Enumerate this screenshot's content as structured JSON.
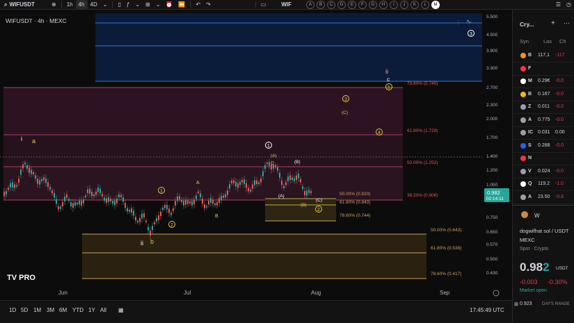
{
  "topbar": {
    "symbol": "WIFUSDT",
    "intervals": [
      "1h",
      "4h",
      "4D"
    ],
    "watch_symbol": "WIF",
    "letters": [
      "A",
      "B",
      "C",
      "D",
      "E",
      "F",
      "G",
      "H",
      "I",
      "J",
      "K",
      "L",
      "M"
    ],
    "selected_letter": "M"
  },
  "chart": {
    "legend": "WIFUSDT · 4h · MEXC",
    "price_axis": [
      "5.500",
      "4.500",
      "3.900",
      "3.300",
      "2.700",
      "2.300",
      "2.000",
      "1.700",
      "1.400",
      "1.200",
      "1.050",
      "0.900",
      "0.750",
      "0.650",
      "0.570",
      "0.500",
      "0.430"
    ],
    "current_price": "0.982",
    "countdown": "02:14:11",
    "time_axis": [
      "Jun",
      "Jul",
      "Aug",
      "Sep"
    ],
    "fib_labels": {
      "f7860_top": "78.60% (2.740)",
      "f6180_top": "61.80% (1.729)",
      "f5000_top": "50.00% (1.252)",
      "f3820": "38.20% (0.906)",
      "f5000_mid": "50.00% (0.920)",
      "f6180_mid": "61.80% (0.843)",
      "f7860_mid": "78.60% (0.744)",
      "f5000_low": "50.00% (0.643)",
      "f6180_low": "61.80% (0.538)",
      "f7860_low": "78.60% (0.417)"
    },
    "wave_labels": {
      "i": "i",
      "a": "a",
      "ii": "ii",
      "b": "b",
      "w1": "1",
      "w2": "2",
      "A": "A",
      "B": "B",
      "c1": "1",
      "paren_A": "(A)",
      "c_small": "C",
      "paren_B": "(B)",
      "paren_A2": "(A)",
      "paren_B2": "(B)",
      "paren_C": "(C)",
      "c2": "2",
      "top_ii": "ii",
      "top_c": "c",
      "top_5": "5",
      "top_3": "3",
      "paren_C_top": "(C)",
      "top_4": "4",
      "corner_3": "3"
    },
    "logo": "TV PRO"
  },
  "bottombar": {
    "ranges": [
      "1D",
      "5D",
      "1M",
      "3M",
      "6M",
      "YTD",
      "1Y",
      "All"
    ],
    "time": "17:45:49 UTC"
  },
  "watchlist": {
    "title": "Cry...",
    "columns": [
      "Syn",
      "Las",
      "Ch"
    ],
    "rows": [
      {
        "name": "B",
        "last": "117,1",
        "chg": "-117",
        "icon": "#f7931a",
        "chg_color": "#f23645"
      },
      {
        "name": "F",
        "last": "",
        "chg": "",
        "icon": "#f23645",
        "chg_color": "#f23645"
      },
      {
        "name": "M",
        "last": "0.29€",
        "chg": "-0.0",
        "icon": "#ffffff",
        "chg_color": "#f23645"
      },
      {
        "name": "B",
        "last": "0.167",
        "chg": "-0.0",
        "icon": "#f0b90b",
        "chg_color": "#f23645"
      },
      {
        "name": "Z",
        "last": "0.011",
        "chg": "-0.0",
        "icon": "#9aa0a6",
        "chg_color": "#f23645"
      },
      {
        "name": "A",
        "last": "0.775",
        "chg": "-0.0",
        "icon": "#9aa0a6",
        "chg_color": "#f23645"
      },
      {
        "name": "IC",
        "last": "0.031",
        "chg": "0.00",
        "icon": "#9aa0a6",
        "chg_color": "#d1d4dc"
      },
      {
        "name": "S",
        "last": "0.288",
        "chg": "-0.0",
        "icon": "#2962ff",
        "chg_color": "#f23645"
      },
      {
        "name": "N",
        "last": "",
        "chg": "",
        "icon": "#f23645",
        "chg_color": "#f23645"
      },
      {
        "name": "V",
        "last": "0.024",
        "chg": "-0.0",
        "icon": "#9aa0a6",
        "chg_color": "#f23645"
      },
      {
        "name": "Q",
        "last": "119.2",
        "chg": "-1.0",
        "icon": "#ffffff",
        "chg_color": "#f23645"
      },
      {
        "name": "A",
        "last": "23.50",
        "chg": "-0.8",
        "icon": "#9aa0a6",
        "chg_color": "#f23645"
      }
    ],
    "detail_sym": "W",
    "detail_name": "dogwifhat sol / USDT",
    "exchange": "MEXC",
    "type": "Spot · Crypto",
    "price_main": "0.98",
    "price_last": "2",
    "price_unit": "USDT",
    "change": "-0.003",
    "change_pct": "-0.30%",
    "market_status": "Market open",
    "day_low": "0.923",
    "day_range_label": "DAY'S RANGE"
  },
  "colors": {
    "up": "#26a69a",
    "down": "#ef5350",
    "fib_red": "#ef5350",
    "fib_gold": "#c8a25a",
    "wave_yellow": "#e6c84a",
    "blue_line": "#2f7bd1"
  }
}
